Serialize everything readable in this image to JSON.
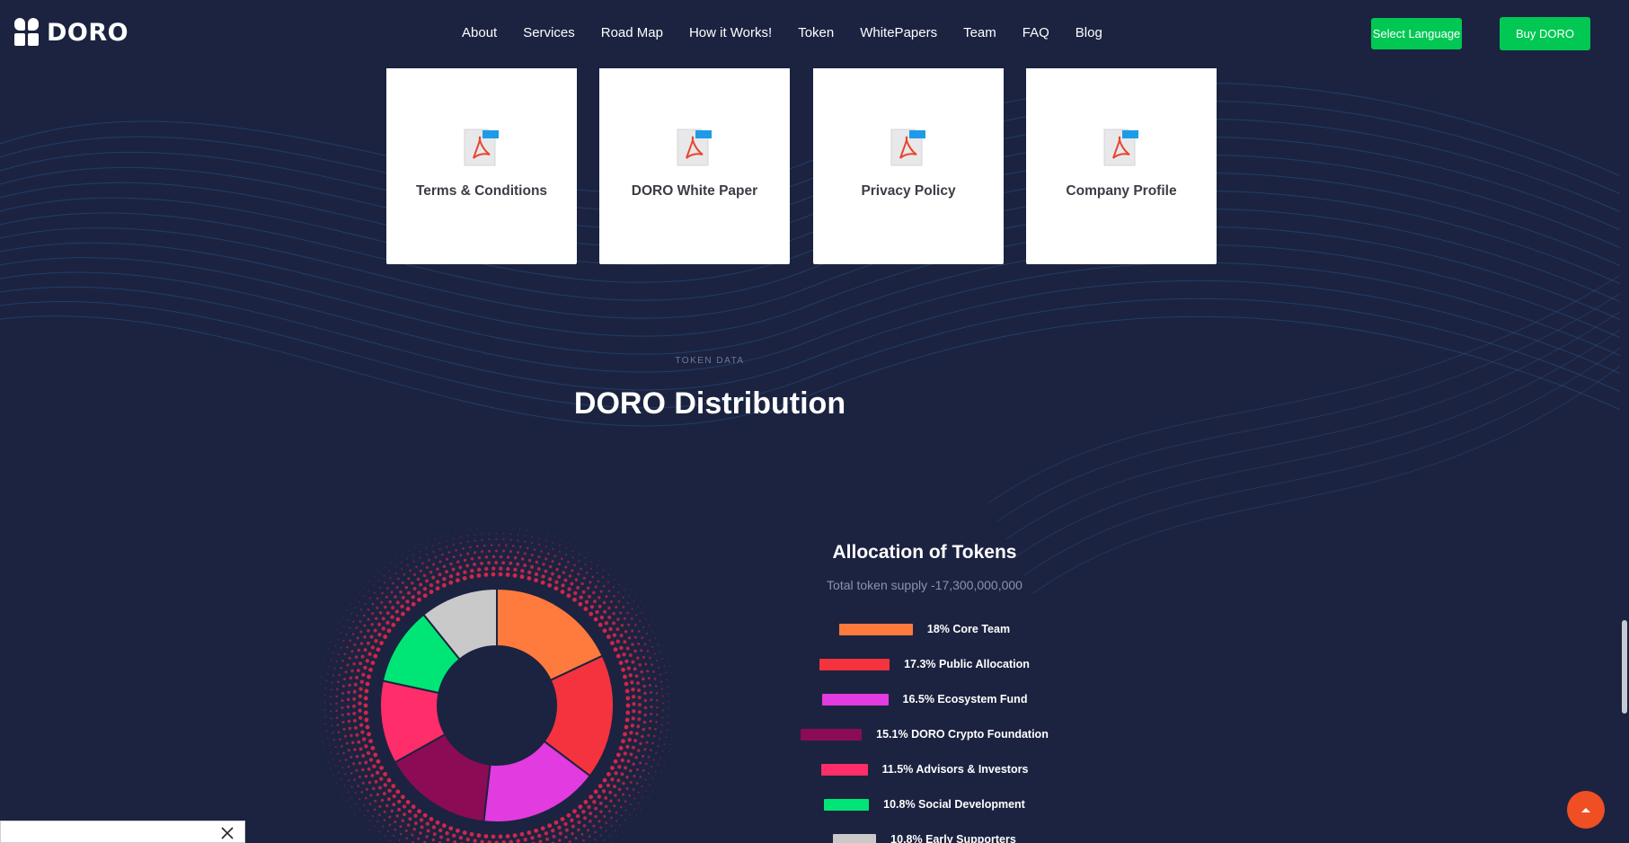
{
  "header": {
    "logo_text": "DORO",
    "nav": [
      "About",
      "Services",
      "Road Map",
      "How it Works!",
      "Token",
      "WhitePapers",
      "Team",
      "FAQ",
      "Blog"
    ],
    "language_button": "Select Language",
    "buy_button": "Buy DORO"
  },
  "documents": [
    {
      "label": "Terms & Conditions",
      "badge": "PDF"
    },
    {
      "label": "DORO White Paper",
      "badge": "PDF"
    },
    {
      "label": "Privacy Policy",
      "badge": "PDF"
    },
    {
      "label": "Company Profile",
      "badge": "PDF"
    }
  ],
  "section": {
    "eyebrow": "TOKEN DATA",
    "title": "DORO Distribution"
  },
  "allocation": {
    "title": "Allocation of Tokens",
    "subtitle": "Total token supply -17,300,000,000",
    "items": [
      {
        "text": "18% Core Team",
        "color": "#ff7a3d"
      },
      {
        "text": "17.3% Public Allocation",
        "color": "#f4333f"
      },
      {
        "text": "16.5% Ecosystem Fund",
        "color": "#e23be0"
      },
      {
        "text": "15.1% DORO Crypto Foundation",
        "color": "#8b0c55"
      },
      {
        "text": "11.5% Advisors & Investors",
        "color": "#ff2d69"
      },
      {
        "text": "10.8% Social Development",
        "color": "#00e676"
      },
      {
        "text": "10.8% Early Supporters",
        "color": "#c9c9c9"
      }
    ]
  },
  "chart_data": {
    "type": "pie",
    "title": "",
    "categories": [
      "Core Team",
      "Public Allocation",
      "Ecosystem Fund",
      "DORO Crypto Foundation",
      "Advisors & Investors",
      "Social Development",
      "Early Supporters"
    ],
    "values": [
      18,
      17.3,
      16.5,
      15.1,
      11.5,
      10.8,
      10.8
    ],
    "colors": [
      "#ff7a3d",
      "#f4333f",
      "#e23be0",
      "#8b0c55",
      "#ff2d69",
      "#00e676",
      "#c9c9c9"
    ],
    "donut": true
  },
  "icons": {
    "scroll_top": "chevron-up-icon",
    "popup_close": "close-icon",
    "document": "pdf-file-icon"
  }
}
